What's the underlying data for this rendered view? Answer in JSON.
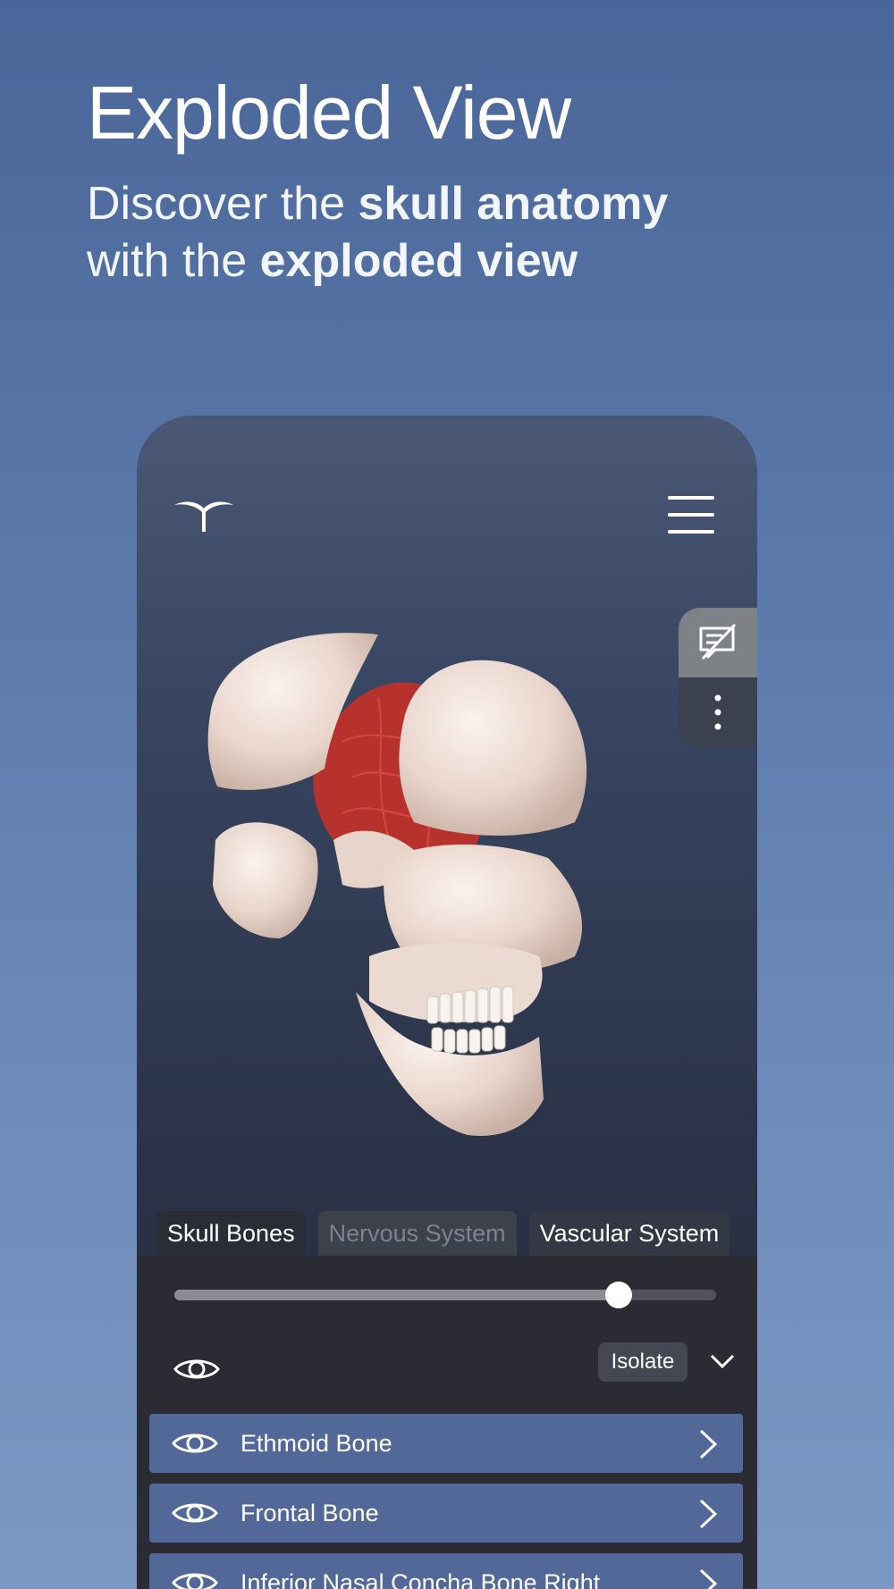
{
  "header": {
    "title": "Exploded View",
    "subtitle_line1_plain": "Discover the ",
    "subtitle_line1_bold": "skull anatomy",
    "subtitle_line2_plain": "with the ",
    "subtitle_line2_bold": "exploded view"
  },
  "app": {
    "logo_icon": "app-logo-icon",
    "menu_icon": "hamburger-menu-icon",
    "side_panel": {
      "annotation_icon": "annotation-off-icon",
      "more_icon": "more-vertical-icon"
    },
    "tabs": [
      {
        "label": "Skull Bones",
        "state": "active"
      },
      {
        "label": "Nervous System",
        "state": "disabled"
      },
      {
        "label": "Vascular System",
        "state": "normal"
      }
    ],
    "slider": {
      "value": 0.82
    },
    "controls": {
      "isolate_label": "Isolate",
      "visibility_icon": "eye-icon",
      "collapse_icon": "chevron-down-icon"
    },
    "list": [
      {
        "label": "Ethmoid Bone"
      },
      {
        "label": "Frontal Bone"
      },
      {
        "label": "Inferior Nasal Concha Bone Right"
      }
    ]
  },
  "colors": {
    "background": "#5a78aa",
    "list_item": "#526898",
    "panel": "#2b2c33",
    "vessels": "#c23a34",
    "bone": "#eddbd2"
  }
}
